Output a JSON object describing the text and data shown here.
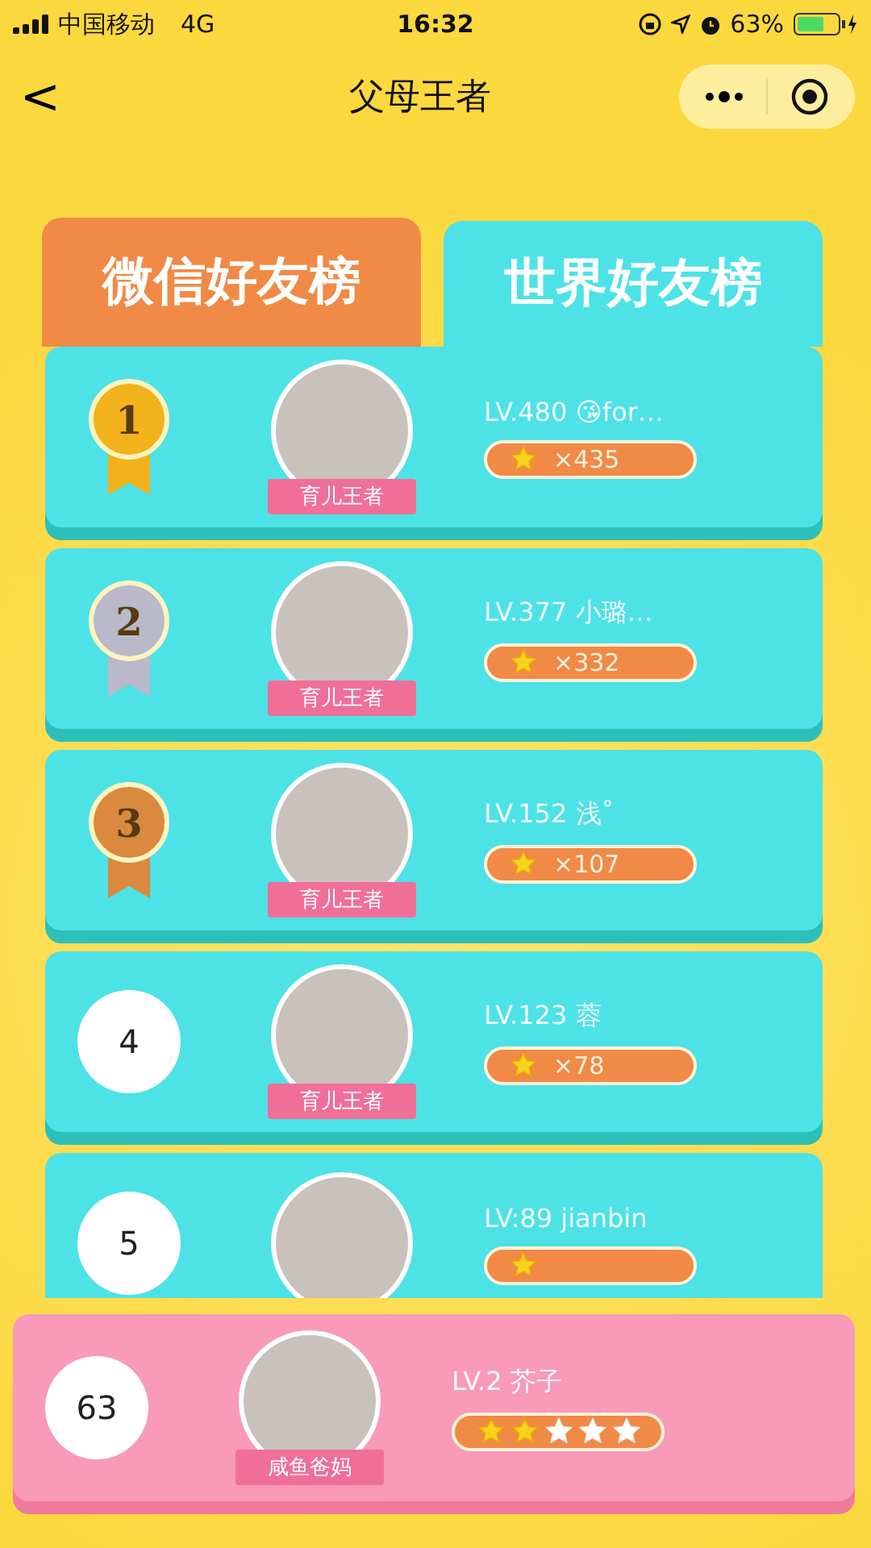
{
  "status_bar": {
    "carrier": "中国移动",
    "network": "4G",
    "time": "16:32",
    "battery": "63%"
  },
  "nav": {
    "title": "父母王者",
    "back": "<"
  },
  "tabs": [
    {
      "label": "微信好友榜",
      "selected": false
    },
    {
      "label": "世界好友榜",
      "selected": true
    }
  ],
  "ranking": [
    {
      "rank": "1",
      "kind": "medal",
      "color": "#f2b21c",
      "title": "育儿王者",
      "name": "LV.480 😘for…",
      "count": "×435"
    },
    {
      "rank": "2",
      "kind": "medal",
      "color": "#b9b9c9",
      "title": "育儿王者",
      "name": "LV.377 小璐…",
      "count": "×332"
    },
    {
      "rank": "3",
      "kind": "medal",
      "color": "#d98a3e",
      "title": "育儿王者",
      "name": "LV.152 浅˚",
      "count": "×107"
    },
    {
      "rank": "4",
      "kind": "circle",
      "title": "育儿王者",
      "name": "LV.123 蓉",
      "count": "×78"
    },
    {
      "rank": "5",
      "kind": "circle",
      "name": "LV:89 jianbin"
    }
  ],
  "my_rank": {
    "rank": "63",
    "title": "咸鱼爸妈",
    "name": "LV.2 芥子",
    "stars": 2
  }
}
